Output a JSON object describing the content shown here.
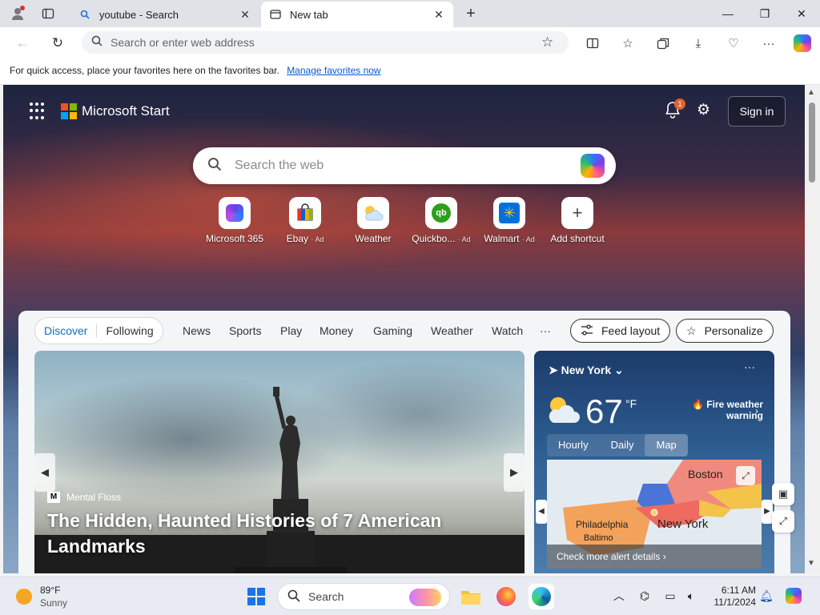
{
  "browser": {
    "tabs": [
      {
        "title": "youtube - Search",
        "favicon": "search-icon"
      },
      {
        "title": "New tab",
        "favicon": "newtab-icon"
      }
    ],
    "address": {
      "placeholder": "Search or enter web address",
      "value": ""
    },
    "favorites_bar": {
      "message": "For quick access, place your favorites here on the favorites bar.",
      "link": "Manage favorites now"
    }
  },
  "start": {
    "brand": "Microsoft Start",
    "notification_count": "1",
    "signin": "Sign in",
    "search_placeholder": "Search the web",
    "shortcuts": [
      {
        "label": "Microsoft 365",
        "ad": ""
      },
      {
        "label": "Ebay",
        "ad": "· Ad"
      },
      {
        "label": "Weather",
        "ad": ""
      },
      {
        "label": "Quickbo...",
        "ad": "· Ad"
      },
      {
        "label": "Walmart",
        "ad": "· Ad"
      },
      {
        "label": "Add shortcut",
        "ad": ""
      }
    ],
    "feed_nav": {
      "segmented": [
        "Discover",
        "Following"
      ],
      "links": [
        "News",
        "Sports",
        "Play",
        "Money",
        "Gaming",
        "Weather",
        "Watch",
        "···"
      ],
      "feed_layout": "Feed layout",
      "personalize": "Personalize"
    },
    "hero": {
      "source": "Mental Floss",
      "headline": "The Hidden, Haunted Histories of 7 American Landmarks"
    },
    "weather": {
      "location": "New York",
      "temp": "67",
      "unit": "°F",
      "alert": "Fire weather warning",
      "tabs": [
        "Hourly",
        "Daily",
        "Map"
      ],
      "map_labels": [
        "Boston",
        "Philadelphia",
        "New York",
        "Baltimo"
      ],
      "cta": "Check more alert details"
    }
  },
  "taskbar": {
    "weather_temp": "89°F",
    "weather_cond": "Sunny",
    "search_label": "Search",
    "time": "6:11 AM",
    "date": "11/1/2024"
  },
  "colors": {
    "accent": "#0f6cbd",
    "alert": "#e0632c"
  }
}
